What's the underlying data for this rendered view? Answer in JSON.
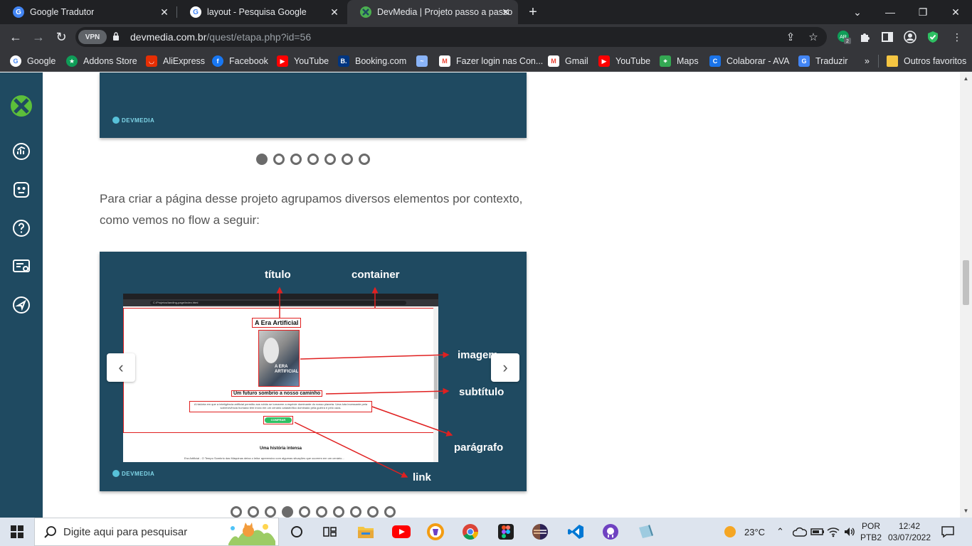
{
  "browser": {
    "tabs": [
      {
        "title": "Google Tradutor",
        "icon": "google-translate-icon"
      },
      {
        "title": "layout - Pesquisa Google",
        "icon": "google-icon"
      },
      {
        "title": "DevMedia | Projeto passo a passo",
        "icon": "devmedia-icon"
      }
    ],
    "vpn_label": "VPN",
    "url_domain": "devmedia.com.br",
    "url_path": "/quest/etapa.php?id=56",
    "extension_badge": "2",
    "extension_label": "AR"
  },
  "bookmarks": [
    {
      "label": "Google",
      "icon": "google-icon",
      "color": "#4285f4"
    },
    {
      "label": "Addons Store",
      "icon": "addons-store-icon",
      "color": "#0f9d58"
    },
    {
      "label": "AliExpress",
      "icon": "aliexpress-icon",
      "color": "#e62e04"
    },
    {
      "label": "Facebook",
      "icon": "facebook-icon",
      "color": "#1877f2"
    },
    {
      "label": "YouTube",
      "icon": "youtube-icon",
      "color": "#ff0000"
    },
    {
      "label": "Booking.com",
      "icon": "booking-icon",
      "color": "#003580"
    },
    {
      "label": "",
      "icon": "bookmark-unlabeled-icon",
      "color": "#8ab4f8"
    },
    {
      "label": "Fazer login nas Con...",
      "icon": "gmail-icon",
      "color": "#ea4335"
    },
    {
      "label": "Gmail",
      "icon": "gmail-icon",
      "color": "#ea4335"
    },
    {
      "label": "YouTube",
      "icon": "youtube-icon",
      "color": "#ff0000"
    },
    {
      "label": "Maps",
      "icon": "maps-icon",
      "color": "#34a853"
    },
    {
      "label": "Colaborar - AVA",
      "icon": "colaborar-icon",
      "color": "#1a73e8"
    },
    {
      "label": "Traduzir",
      "icon": "google-translate-icon",
      "color": "#4285f4"
    }
  ],
  "bookmarks_more": "»",
  "other_favorites": "Outros favoritos",
  "page": {
    "brand_small": "DEVMEDIA",
    "paragraph": "Para criar a página desse projeto agrupamos diversos elementos por contexto, como vemos no flow a seguir:",
    "carousel_top": {
      "count": 7,
      "active": 0
    },
    "carousel_flow": {
      "count": 10,
      "active": 3
    },
    "flow": {
      "labels": {
        "titulo": "título",
        "container": "container",
        "imagem": "imagem",
        "subtitulo": "subtítulo",
        "paragrafo": "parágrafo",
        "link": "link"
      },
      "mock": {
        "url": "C:/Projetos/landing-page/index.html",
        "title": "A Era Artificial",
        "cover_text": "A ERA ARTIFICIAL",
        "subtitle": "Um futuro sombrio a nosso caminho",
        "paragraph": "A história em que a inteligência artificial permitiu aos robôs se tornarem a espécie dominante do nosso planeta. Uma luta incessante pela sobrevivência humana tem início em um cenário catastrófico dominado pela guerra e pelo caos.",
        "button": "COMPRAR",
        "section_title": "Uma história intensa",
        "body_text": "Era Artificial - O Tempo Sombrio das Máquinas deixa o leitor apreensivo com algumas situações que ocorrem em um cenário..."
      }
    }
  },
  "taskbar": {
    "search_placeholder": "Digite aqui para pesquisar",
    "weather": "23°C",
    "lang_top": "POR",
    "lang_bottom": "PTB2",
    "time": "12:42",
    "date": "03/07/2022"
  },
  "colors": {
    "devmedia_blue": "#1f4a61",
    "highlight_red": "#e02020"
  }
}
